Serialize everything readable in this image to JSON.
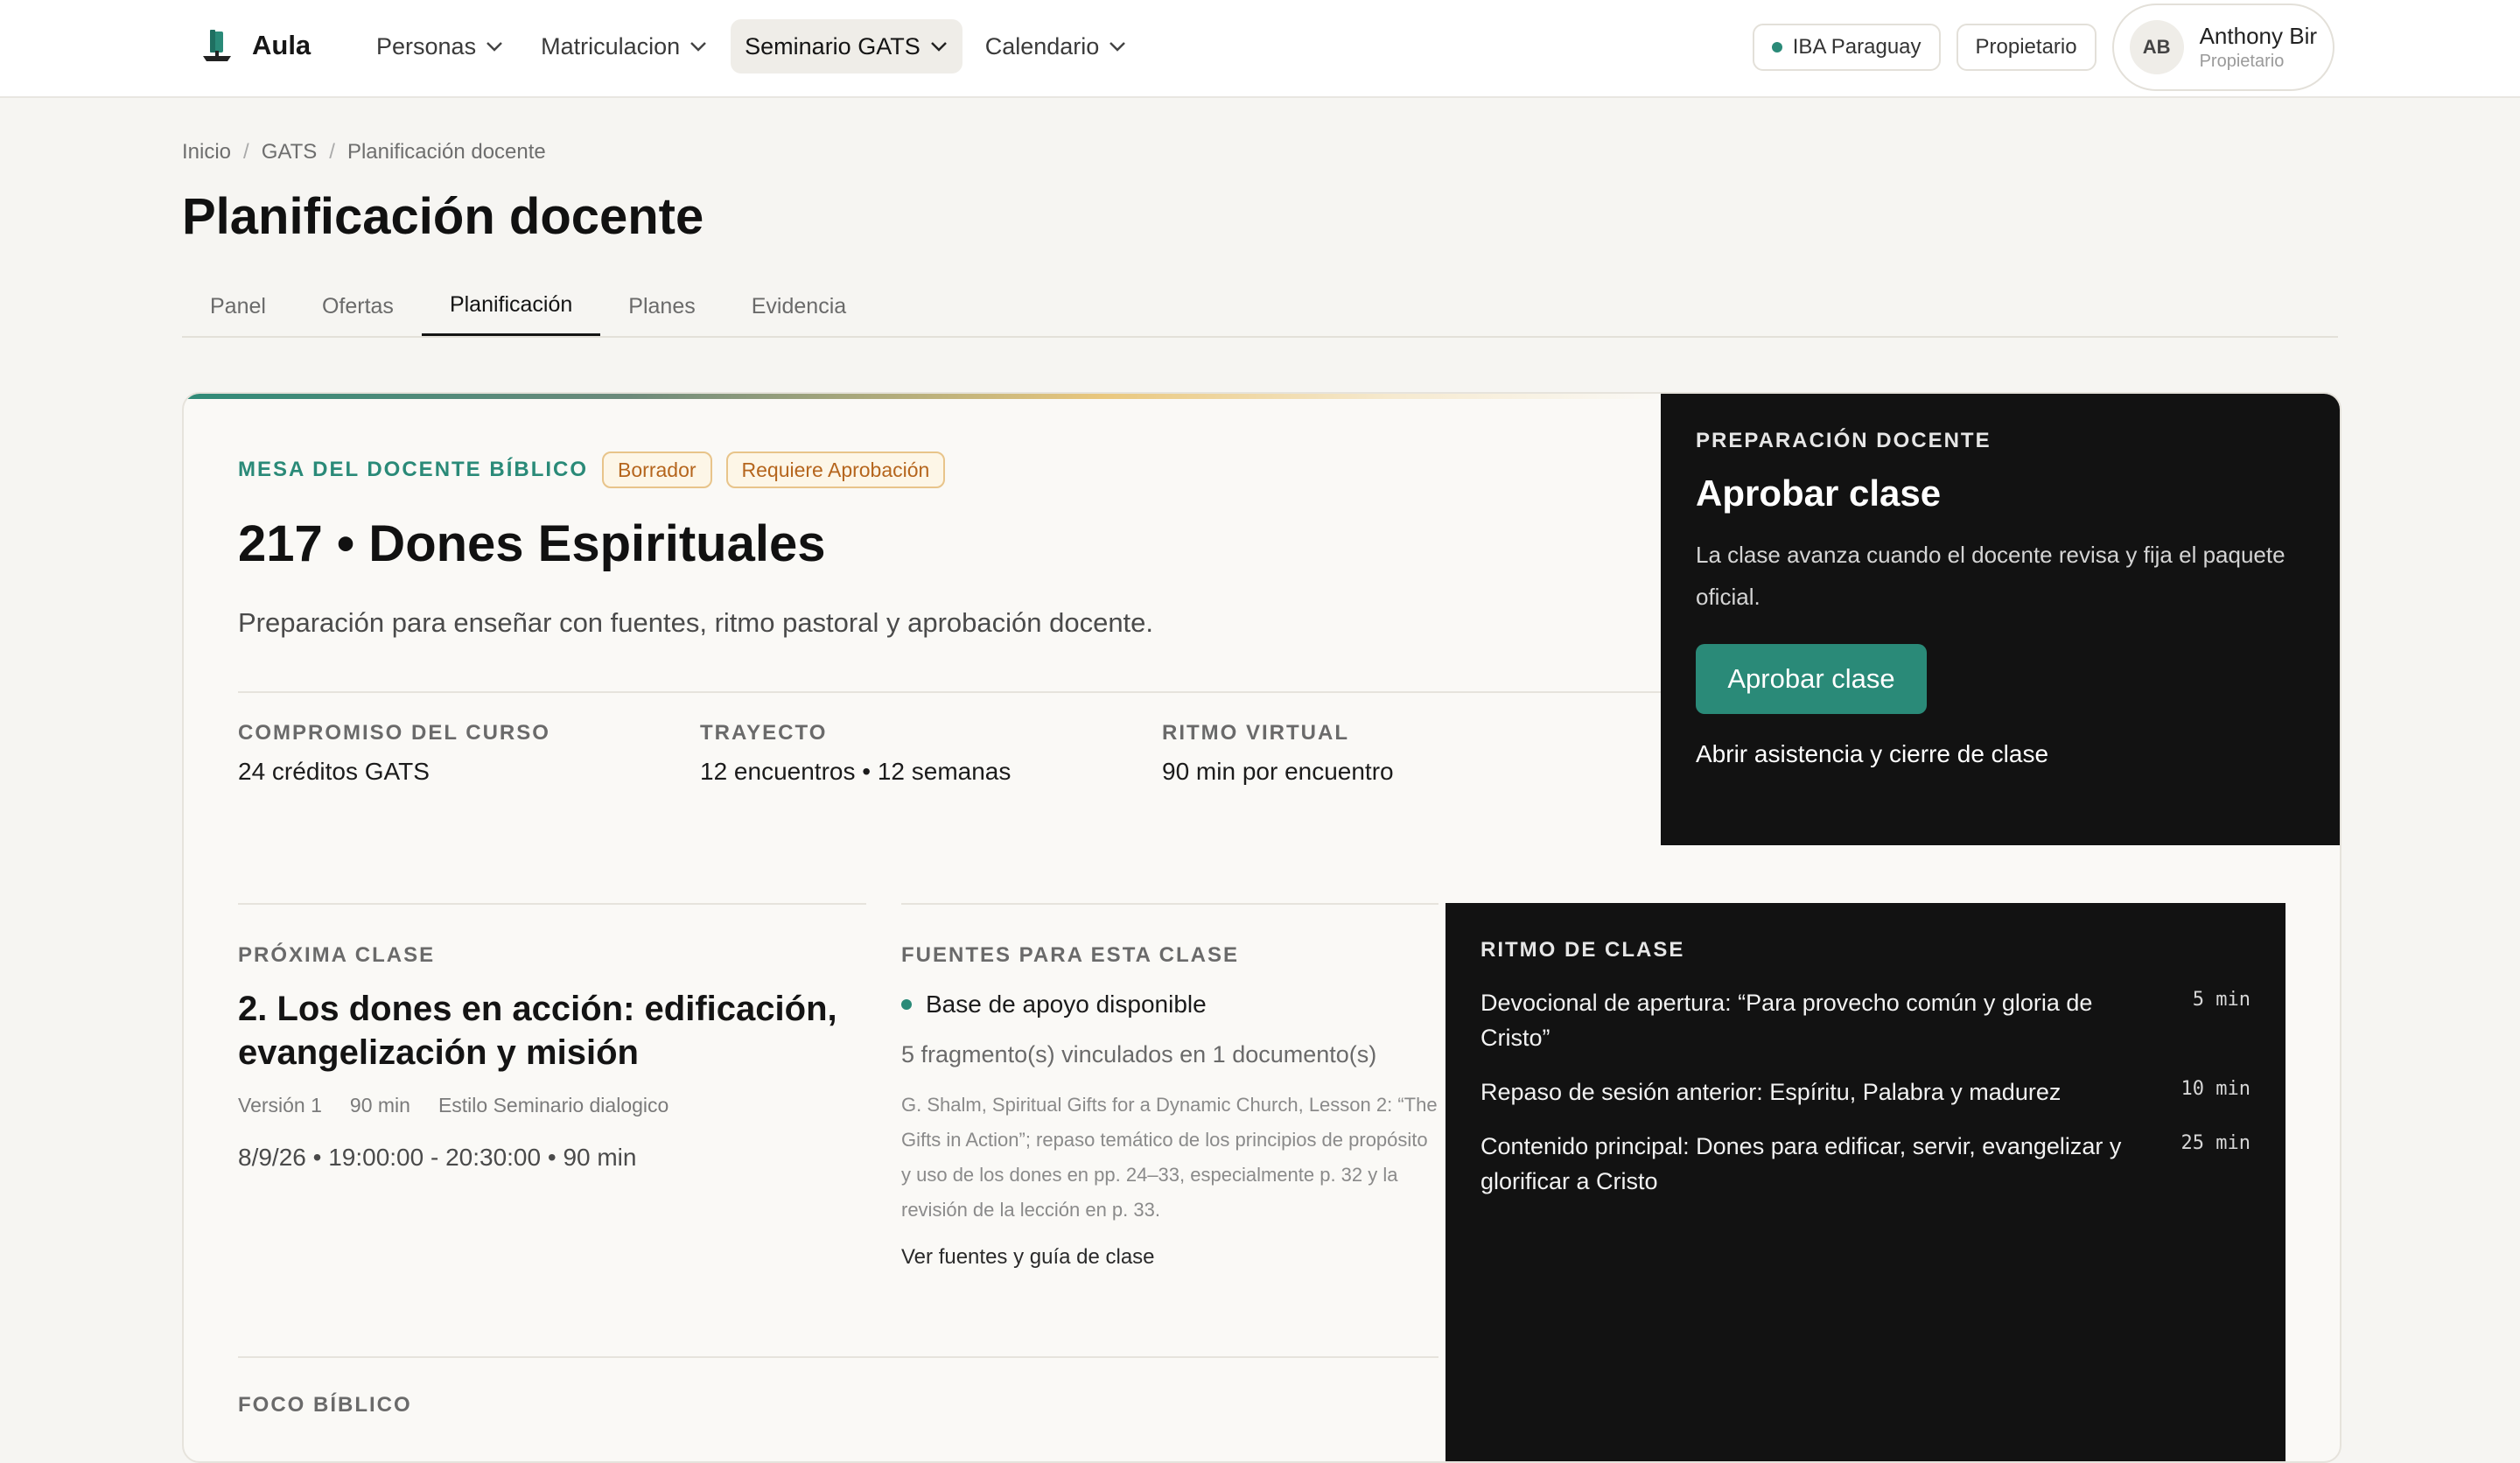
{
  "app": {
    "name": "Aula"
  },
  "nav": [
    {
      "label": "Personas",
      "active": false
    },
    {
      "label": "Matriculacion",
      "active": false
    },
    {
      "label": "Seminario GATS",
      "active": true
    },
    {
      "label": "Calendario",
      "active": false
    }
  ],
  "header": {
    "org": "IBA Paraguay",
    "role_chip": "Propietario",
    "user": {
      "initials": "AB",
      "name": "Anthony Bir",
      "role": "Propietario"
    }
  },
  "breadcrumb": [
    "Inicio",
    "GATS",
    "Planificación docente"
  ],
  "page_title": "Planificación docente",
  "tabs": [
    {
      "label": "Panel",
      "active": false
    },
    {
      "label": "Ofertas",
      "active": false
    },
    {
      "label": "Planificación",
      "active": true
    },
    {
      "label": "Planes",
      "active": false
    },
    {
      "label": "Evidencia",
      "active": false
    }
  ],
  "course": {
    "kicker": "MESA DEL DOCENTE BÍBLICO",
    "badges": [
      "Borrador",
      "Requiere Aprobación"
    ],
    "title": "217 • Dones Espirituales",
    "subtitle": "Preparación para enseñar con fuentes, ritmo pastoral y aprobación docente.",
    "stats": [
      {
        "label": "COMPROMISO DEL CURSO",
        "value": "24 créditos GATS"
      },
      {
        "label": "TRAYECTO",
        "value": "12 encuentros • 12 semanas"
      },
      {
        "label": "RITMO VIRTUAL",
        "value": "90 min por encuentro"
      }
    ]
  },
  "prep": {
    "kicker": "PREPARACIÓN DOCENTE",
    "title": "Aprobar clase",
    "text": "La clase avanza cuando el docente revisa y fija el paquete oficial.",
    "button": "Aprobar clase",
    "link": "Abrir asistencia y cierre de clase"
  },
  "next_class": {
    "label": "PRÓXIMA CLASE",
    "title": "2. Los dones en acción: edificación, evangelización y misión",
    "meta": [
      "Versión 1",
      "90 min",
      "Estilo Seminario dialogico"
    ],
    "time": "8/9/26 • 19:00:00 - 20:30:00 • 90 min"
  },
  "sources": {
    "label": "FUENTES PARA ESTA CLASE",
    "status": "Base de apoyo disponible",
    "count": "5 fragmento(s) vinculados en 1 documento(s)",
    "description": "G. Shalm, Spiritual Gifts for a Dynamic Church, Lesson 2: “The Gifts in Action”; repaso temático de los principios de propósito y uso de los dones en pp. 24–33, especialmente p. 32 y la revisión de la lección en p. 33.",
    "link": "Ver fuentes y guía de clase"
  },
  "rhythm": {
    "label": "RITMO DE CLASE",
    "items": [
      {
        "text": "Devocional de apertura: “Para provecho común y gloria de Cristo”",
        "duration": "5 min"
      },
      {
        "text": "Repaso de sesión anterior: Espíritu, Palabra y madurez",
        "duration": "10 min"
      },
      {
        "text": "Contenido principal: Dones para edificar, servir, evangelizar y glorificar a Cristo",
        "duration": "25 min"
      }
    ]
  },
  "focus": {
    "label": "FOCO BÍBLICO"
  },
  "colors": {
    "accent": "#2a8a78",
    "dark_panel": "#121212",
    "badge_text": "#b5651d"
  }
}
